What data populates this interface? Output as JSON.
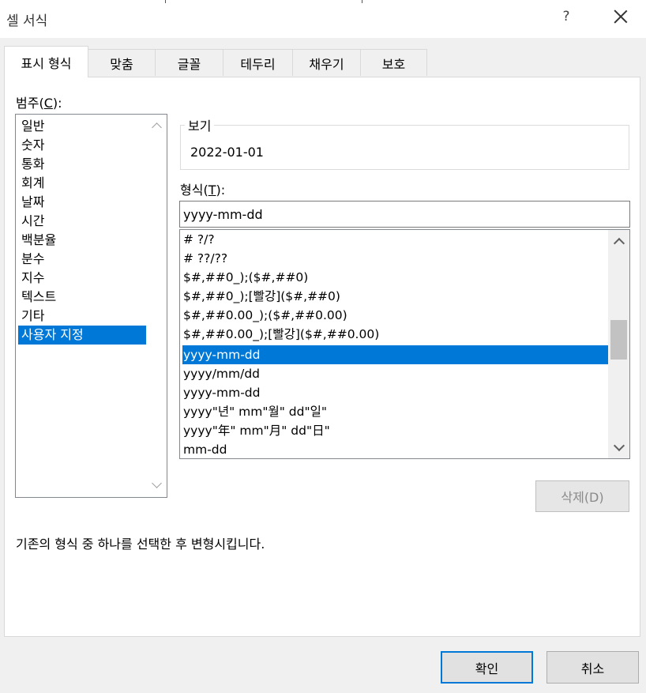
{
  "dialog": {
    "title": "셀 서식",
    "help": "?"
  },
  "tabs": [
    {
      "label": "표시 형식",
      "active": true
    },
    {
      "label": "맞춤"
    },
    {
      "label": "글꼴"
    },
    {
      "label": "테두리"
    },
    {
      "label": "채우기"
    },
    {
      "label": "보호"
    }
  ],
  "category": {
    "label_pre": "범주(",
    "label_key": "C",
    "label_post": "):",
    "items": [
      "일반",
      "숫자",
      "통화",
      "회계",
      "날짜",
      "시간",
      "백분율",
      "분수",
      "지수",
      "텍스트",
      "기타",
      "사용자 지정"
    ],
    "selected": "사용자 지정"
  },
  "sample": {
    "label": "보기",
    "value": "2022-01-01"
  },
  "format": {
    "label_pre": "형식(",
    "label_key": "T",
    "label_post": "):",
    "value": "yyyy-mm-dd",
    "items": [
      "# ?/?",
      "# ??/??",
      "$#,##0_);($#,##0)",
      "$#,##0_);[빨강]($#,##0)",
      "$#,##0.00_);($#,##0.00)",
      "$#,##0.00_);[빨강]($#,##0.00)",
      "yyyy-mm-dd",
      "yyyy/mm/dd",
      "yyyy-mm-dd",
      "yyyy\"년\" mm\"월\" dd\"일\"",
      "yyyy\"年\" mm\"月\" dd\"日\"",
      "mm-dd"
    ],
    "selected_index": 6
  },
  "delete_button": "삭제(D)",
  "description": "기존의 형식 중 하나를 선택한 후 변형시킵니다.",
  "buttons": {
    "ok": "확인",
    "cancel": "취소"
  },
  "colors": {
    "selection": "#0078d7",
    "panel": "#ffffff",
    "background": "#f0f0f0"
  }
}
